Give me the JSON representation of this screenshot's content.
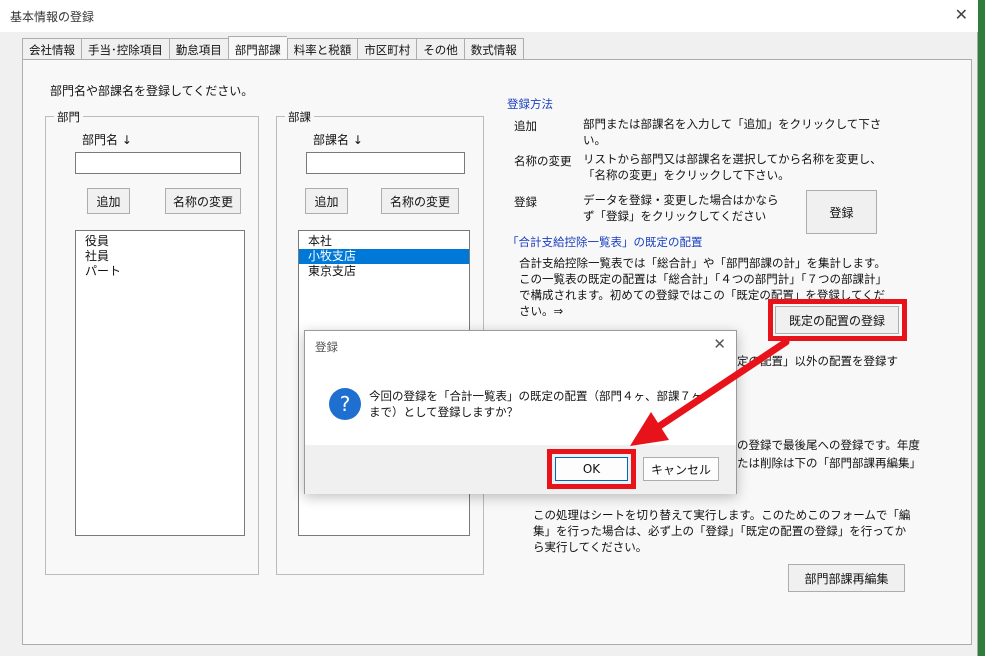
{
  "window": {
    "title": "基本情報の登録",
    "close": "✕"
  },
  "tabs": [
    "会社情報",
    "手当･控除項目",
    "勤怠項目",
    "部門部課",
    "料率と税額",
    "市区町村",
    "その他",
    "数式情報"
  ],
  "intro": "部門名や部課名を登録してください。",
  "dept": {
    "legend": "部門",
    "field_label": "部門名 ↓",
    "input_value": "",
    "add": "追加",
    "rename": "名称の変更",
    "items": [
      "役員",
      "社員",
      "パート"
    ]
  },
  "section": {
    "legend": "部課",
    "field_label": "部課名 ↓",
    "input_value": "",
    "add": "追加",
    "rename": "名称の変更",
    "items": [
      "本社",
      "小牧支店",
      "東京支店"
    ],
    "selected": 1
  },
  "help": {
    "method_title": "登録方法",
    "add_label": "追加",
    "add_text": "部門または部課名を入力して「追加」をクリックして下さい。",
    "rename_label": "名称の変更",
    "rename_text": "リストから部門又は部課名を選択してから名称を変更し、「名称の変更」をクリックして下さい。",
    "register_label": "登録",
    "register_text": "データを登録・変更した場合はかならず「登録」をクリックしてください",
    "register_button": "登録",
    "default_title": "「合計支給控除一覧表」の既定の配置",
    "default_text": "合計支給控除一覧表では「総合計」や「部門部課の計」を集計します。この一覧表の既定の配置は「総合計」「４つの部門計」「７つの部課計」で構成されます。初めての登録ではこの「既定の配置」を登録してください。⇒",
    "default_button": "既定の配置の登録",
    "partial_1": "定の配置」以外の配置を登録す",
    "partial_2": "の登録で最後尾への登録です。年度",
    "partial_3": "たは削除は下の「部門部課再編集」",
    "note_text": "この処理はシートを切り替えて実行します。このためこのフォームで「編集」を行った場合は、必ず上の「登録」「既定の配置の登録」を行ってから実行してください。",
    "reedit_button": "部門部課再編集"
  },
  "dialog": {
    "title": "登録",
    "close": "✕",
    "icon": "?",
    "message": "今回の登録を「合計一覧表」の既定の配置（部門４ヶ、部課７ヶまで）として登録しますか？",
    "ok": "OK",
    "cancel": "キャンセル"
  },
  "colors": {
    "highlight": "#e8121a",
    "selection": "#0078d7",
    "link": "#1a3fc0",
    "icon": "#1f6fd0"
  }
}
